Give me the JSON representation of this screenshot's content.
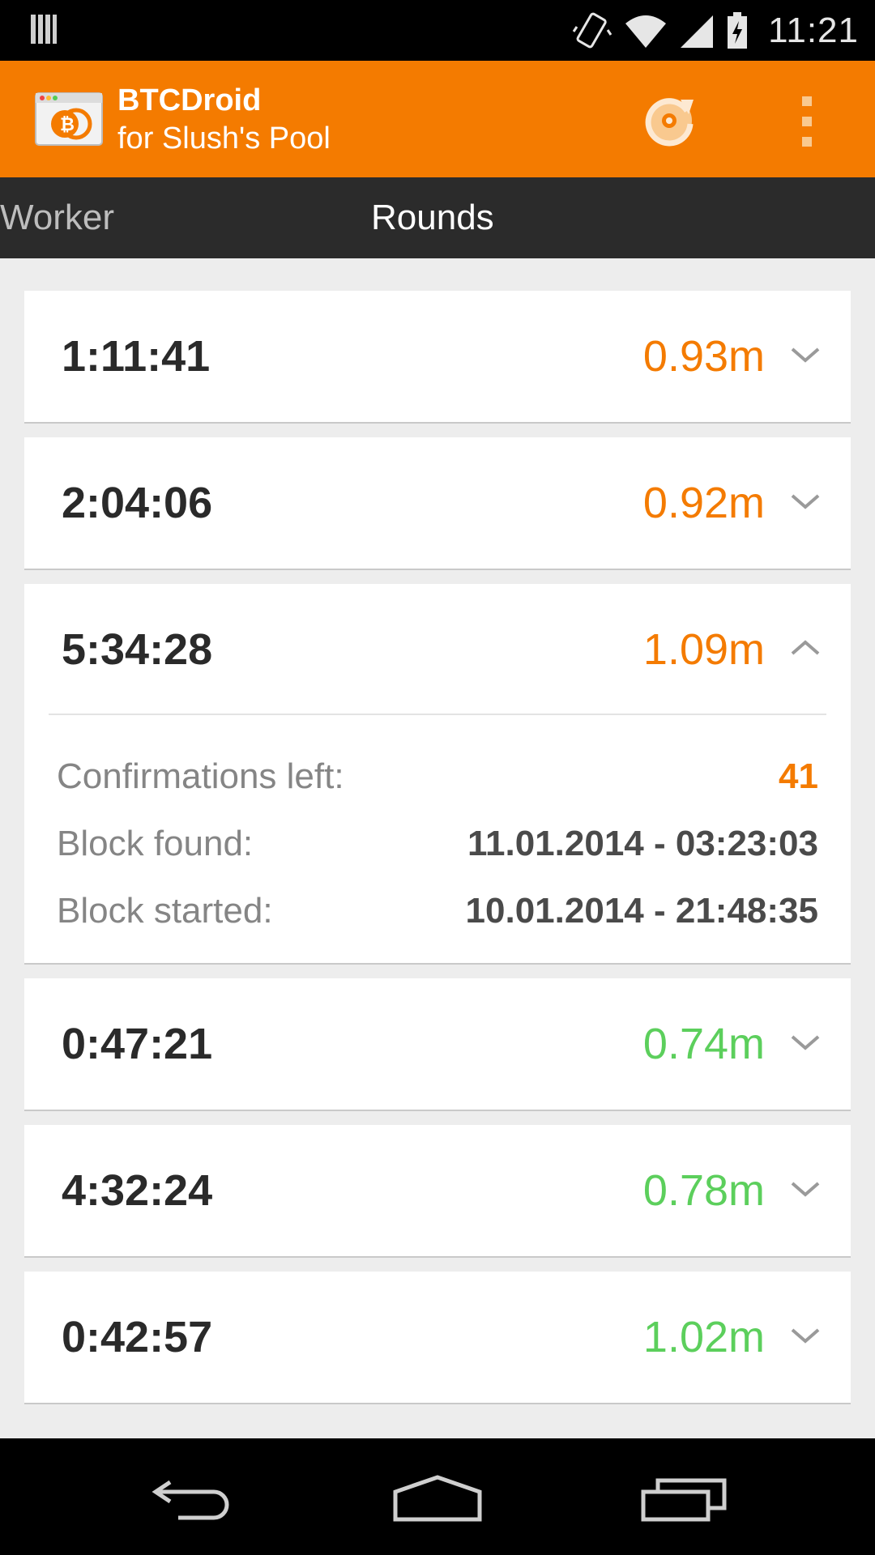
{
  "status_bar": {
    "time": "11:21",
    "icons": [
      "notification-icon",
      "vibrate-icon",
      "wifi-icon",
      "cell-signal-icon",
      "battery-charging-icon"
    ]
  },
  "app": {
    "title": "BTCDroid",
    "subtitle": "for Slush's Pool",
    "accent_color": "#f47b00",
    "actions": [
      "refresh-icon",
      "overflow-menu-icon"
    ]
  },
  "tabs": [
    {
      "label": "Worker",
      "selected": false
    },
    {
      "label": "Rounds",
      "selected": true
    }
  ],
  "rounds": [
    {
      "duration": "1:11:41",
      "value": "0.93m",
      "color": "#f47b00",
      "expanded": false
    },
    {
      "duration": "2:04:06",
      "value": "0.92m",
      "color": "#f47b00",
      "expanded": false
    },
    {
      "duration": "5:34:28",
      "value": "1.09m",
      "color": "#f47b00",
      "expanded": true,
      "details": {
        "confirmations_label": "Confirmations left:",
        "confirmations_value": "41",
        "block_found_label": "Block found:",
        "block_found_value": "11.01.2014 - 03:23:03",
        "block_started_label": "Block started:",
        "block_started_value": "10.01.2014 - 21:48:35"
      }
    },
    {
      "duration": "0:47:21",
      "value": "0.74m",
      "color": "#5ccf5c",
      "expanded": false
    },
    {
      "duration": "4:32:24",
      "value": "0.78m",
      "color": "#5ccf5c",
      "expanded": false
    },
    {
      "duration": "0:42:57",
      "value": "1.02m",
      "color": "#5ccf5c",
      "expanded": false
    }
  ],
  "nav_bar": [
    "back-icon",
    "home-icon",
    "recent-apps-icon"
  ]
}
